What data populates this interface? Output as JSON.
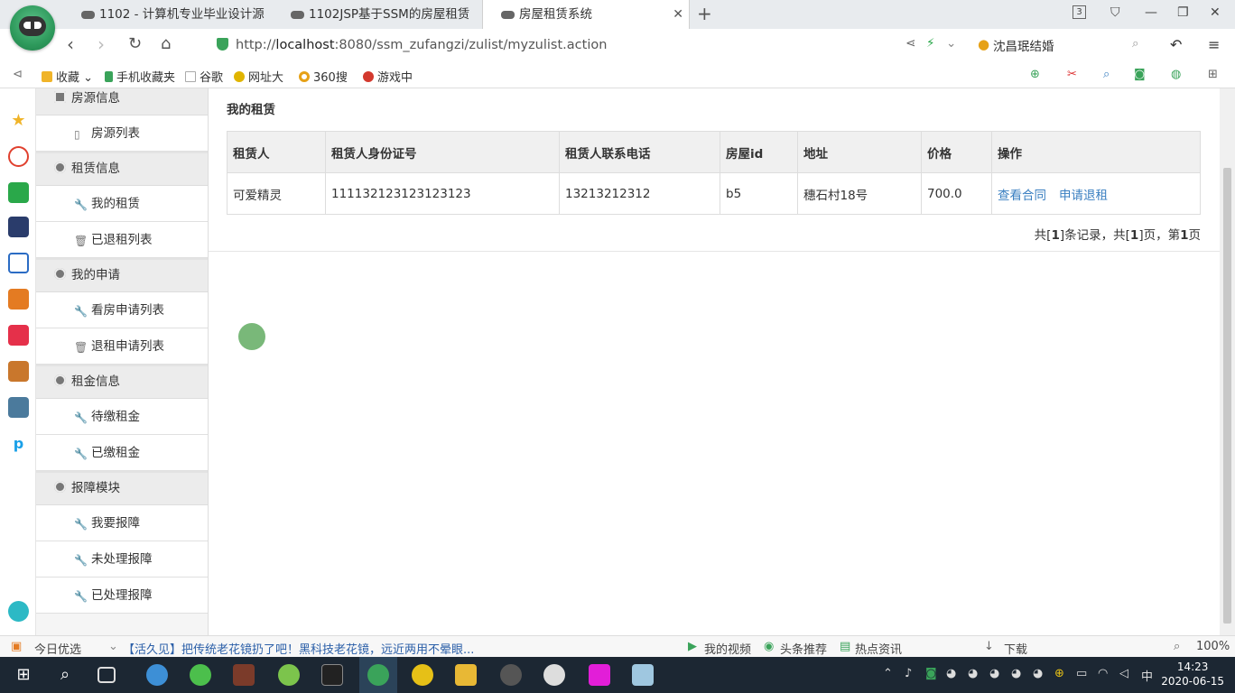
{
  "browser": {
    "tabs": [
      {
        "title": "1102 - 计算机专业毕业设计源"
      },
      {
        "title": "1102JSP基于SSM的房屋租赁"
      },
      {
        "title": "房屋租赁系统"
      }
    ],
    "tab_counter": "3",
    "url_prefix": "http://",
    "url_host": "localhost",
    "url_rest": ":8080/ssm_zufangzi/zulist/myzulist.action",
    "search_text": "沈昌珉结婚",
    "bookmarks": [
      "收藏",
      "手机收藏夹",
      "谷歌",
      "网址大",
      "360搜",
      "游戏中"
    ]
  },
  "sidebar": {
    "groups": [
      {
        "label": "房源信息",
        "items": [
          "房源列表"
        ]
      },
      {
        "label": "租赁信息",
        "items": [
          "我的租赁",
          "已退租列表"
        ]
      },
      {
        "label": "我的申请",
        "items": [
          "看房申请列表",
          "退租申请列表"
        ]
      },
      {
        "label": "租金信息",
        "items": [
          "待缴租金",
          "已缴租金"
        ]
      },
      {
        "label": "报障模块",
        "items": [
          "我要报障",
          "未处理报障",
          "已处理报障"
        ]
      }
    ]
  },
  "main": {
    "title": "我的租赁",
    "columns": [
      "租赁人",
      "租赁人身份证号",
      "租赁人联系电话",
      "房屋id",
      "地址",
      "价格",
      "操作"
    ],
    "rows": [
      {
        "name": "可爱精灵",
        "id_card": "111132123123123123",
        "phone": "13213212312",
        "house_id": "b5",
        "address": "穗石村18号",
        "price": "700.0",
        "actions": [
          "查看合同",
          "申请退租"
        ]
      }
    ],
    "pager": {
      "text_a": "共[",
      "records": "1",
      "text_b": "]条记录，共[",
      "pages": "1",
      "text_c": "]页，第",
      "current": "1",
      "text_d": "页"
    }
  },
  "status": {
    "today": "今日优选",
    "news": "【活久见】把传统老花镜扔了吧！黑科技老花镜，远近两用不晕眼...",
    "my_video": "我的视频",
    "headline": "头条推荐",
    "hot": "热点资讯",
    "download": "下载",
    "zoom": "100%"
  },
  "taskbar": {
    "time": "14:23",
    "date": "2020-06-15",
    "ime": "中"
  }
}
